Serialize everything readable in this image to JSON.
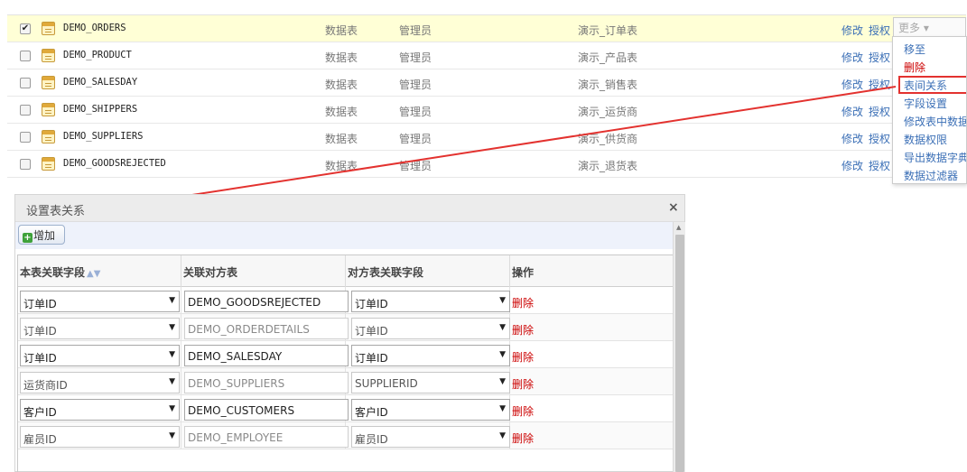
{
  "tables": [
    {
      "name": "DEMO_ORDERS",
      "type": "数据表",
      "owner": "管理员",
      "desc": "演示_订单表",
      "checked": true,
      "edit": "修改",
      "grant": "授权"
    },
    {
      "name": "DEMO_PRODUCT",
      "type": "数据表",
      "owner": "管理员",
      "desc": "演示_产品表",
      "checked": false,
      "edit": "修改",
      "grant": "授权"
    },
    {
      "name": "DEMO_SALESDAY",
      "type": "数据表",
      "owner": "管理员",
      "desc": "演示_销售表",
      "checked": false,
      "edit": "修改",
      "grant": "授权"
    },
    {
      "name": "DEMO_SHIPPERS",
      "type": "数据表",
      "owner": "管理员",
      "desc": "演示_运货商",
      "checked": false,
      "edit": "修改",
      "grant": "授权"
    },
    {
      "name": "DEMO_SUPPLIERS",
      "type": "数据表",
      "owner": "管理员",
      "desc": "演示_供货商",
      "checked": false,
      "edit": "修改",
      "grant": "授权"
    },
    {
      "name": "DEMO_GOODSREJECTED",
      "type": "数据表",
      "owner": "管理员",
      "desc": "演示_退货表",
      "checked": false,
      "edit": "修改",
      "grant": "授权"
    }
  ],
  "more_menu": {
    "button_label": "更多",
    "items": [
      {
        "label": "移至",
        "danger": false,
        "highlighted": false
      },
      {
        "label": "删除",
        "danger": true,
        "highlighted": false
      },
      {
        "label": "表间关系",
        "danger": false,
        "highlighted": true
      },
      {
        "label": "字段设置",
        "danger": false,
        "highlighted": false
      },
      {
        "label": "修改表中数据",
        "danger": false,
        "highlighted": false
      },
      {
        "label": "数据权限",
        "danger": false,
        "highlighted": false
      },
      {
        "label": "导出数据字典",
        "danger": false,
        "highlighted": false
      },
      {
        "label": "数据过滤器",
        "danger": false,
        "highlighted": false
      }
    ]
  },
  "dialog": {
    "title": "设置表关系",
    "close": "×",
    "add_button": "增加",
    "columns": [
      "本表关联字段",
      "关联对方表",
      "对方表关联字段",
      "操作"
    ],
    "rows": [
      {
        "local_field": "订单ID",
        "target_table": "DEMO_GOODSREJECTED",
        "target_field": "订单ID",
        "action": "删除",
        "active": true
      },
      {
        "local_field": "订单ID",
        "target_table": "DEMO_ORDERDETAILS",
        "target_field": "订单ID",
        "action": "删除",
        "active": false
      },
      {
        "local_field": "订单ID",
        "target_table": "DEMO_SALESDAY",
        "target_field": "订单ID",
        "action": "删除",
        "active": true
      },
      {
        "local_field": "运货商ID",
        "target_table": "DEMO_SUPPLIERS",
        "target_field": "SUPPLIERID",
        "action": "删除",
        "active": false
      },
      {
        "local_field": "客户ID",
        "target_table": "DEMO_CUSTOMERS",
        "target_field": "客户ID",
        "action": "删除",
        "active": true
      },
      {
        "local_field": "雇员ID",
        "target_table": "DEMO_EMPLOYEE",
        "target_field": "雇员ID",
        "action": "删除",
        "active": false
      }
    ]
  },
  "colors": {
    "selected_row": "#ffffd6",
    "link": "#3b6fb6",
    "danger": "#cc0000",
    "annotation_red": "#e3322f"
  }
}
